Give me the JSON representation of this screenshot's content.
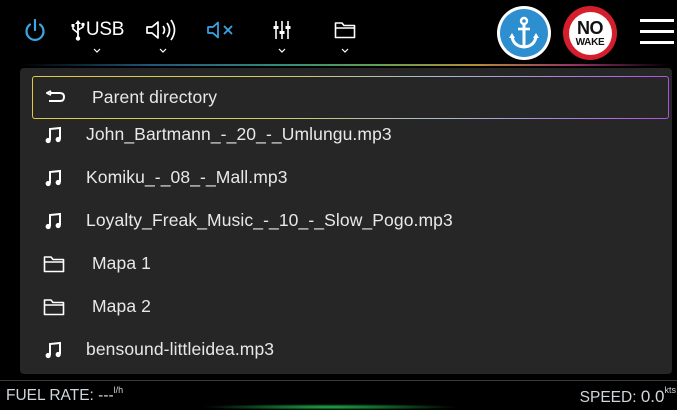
{
  "toolbar": {
    "power_icon": "power-icon",
    "source_label": "USB",
    "volume_icon": "speaker-volume-icon",
    "mute_icon": "speaker-mute-icon",
    "eq_icon": "equalizer-sliders-icon",
    "folder_icon": "folder-icon",
    "anchor_icon": "anchor-icon",
    "no_wake_top": "NO",
    "no_wake_bottom": "WAKE",
    "menu_icon": "hamburger-menu-icon",
    "accent_color": "#3aa7e8",
    "anchor_color": "#2d8fd0",
    "no_wake_color": "#d51e2b"
  },
  "file_list": {
    "items": [
      {
        "type": "parent",
        "icon": "return-arrow-icon",
        "label": "Parent directory",
        "selected": true
      },
      {
        "type": "file",
        "icon": "music-note-icon",
        "label": "John_Bartmann_-_20_-_Umlungu.mp3"
      },
      {
        "type": "file",
        "icon": "music-note-icon",
        "label": "Komiku_-_08_-_Mall.mp3"
      },
      {
        "type": "file",
        "icon": "music-note-icon",
        "label": "Loyalty_Freak_Music_-_10_-_Slow_Pogo.mp3"
      },
      {
        "type": "folder",
        "icon": "folder-icon",
        "label": "Mapa 1"
      },
      {
        "type": "folder",
        "icon": "folder-icon",
        "label": "Mapa 2"
      },
      {
        "type": "file",
        "icon": "music-note-icon",
        "label": "bensound-littleidea.mp3"
      }
    ]
  },
  "status": {
    "fuel_label": "FUEL RATE:",
    "fuel_value": "---",
    "fuel_unit": "l/h",
    "speed_label": "SPEED:",
    "speed_value": "0.0",
    "speed_unit": "kts"
  }
}
